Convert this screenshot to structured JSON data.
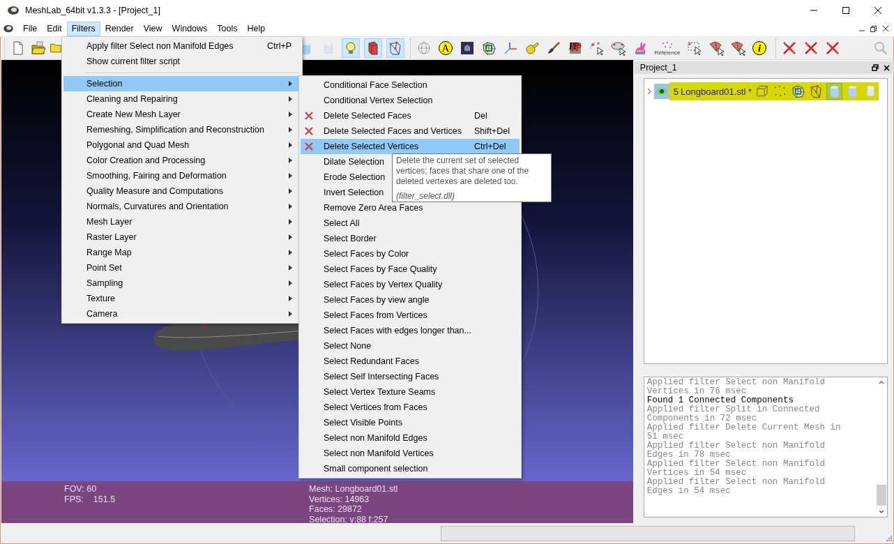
{
  "window": {
    "title": "MeshLab_64bit v1.3.3 - [Project_1]"
  },
  "menubar": [
    {
      "label": "File",
      "selected": false
    },
    {
      "label": "Edit",
      "selected": false
    },
    {
      "label": "Filters",
      "selected": true
    },
    {
      "label": "Render",
      "selected": false
    },
    {
      "label": "View",
      "selected": false
    },
    {
      "label": "Windows",
      "selected": false
    },
    {
      "label": "Tools",
      "selected": false
    },
    {
      "label": "Help",
      "selected": false
    }
  ],
  "toolbar": [
    [
      {
        "selected": false
      },
      {
        "selected": false
      },
      {
        "selected": false
      }
    ],
    [
      {
        "selected": false
      },
      {
        "selected": false
      },
      {
        "selected": true
      },
      {
        "selected": true
      },
      {
        "selected": true
      }
    ],
    [
      {
        "selected": false
      },
      {
        "selected": false,
        "label": "A"
      },
      {
        "selected": false
      },
      {
        "selected": false
      },
      {
        "selected": false
      },
      {
        "selected": false
      },
      {
        "selected": false
      },
      {
        "selected": false,
        "label": "PP"
      },
      {
        "selected": false
      },
      {
        "selected": false
      },
      {
        "selected": false
      },
      {
        "selected": false,
        "label": "Reference"
      },
      {
        "selected": false
      },
      {
        "selected": false
      },
      {
        "selected": false
      },
      {
        "selected": false,
        "label": "i"
      }
    ],
    [
      {
        "selected": false
      },
      {
        "selected": false
      },
      {
        "selected": false
      }
    ],
    [
      {
        "selected": false
      }
    ]
  ],
  "filters_menu": [
    {
      "kind": "action",
      "label": "Apply filter Select non Manifold Edges",
      "shortcut": "Ctrl+P",
      "selected": false
    },
    {
      "kind": "action",
      "label": "Show current filter script",
      "selected": false
    },
    {
      "kind": "separator"
    },
    {
      "kind": "submenu",
      "label": "Selection",
      "selected": true
    },
    {
      "kind": "submenu",
      "label": "Cleaning and Repairing",
      "selected": false
    },
    {
      "kind": "submenu",
      "label": "Create New Mesh Layer",
      "selected": false
    },
    {
      "kind": "submenu",
      "label": "Remeshing, Simplification and Reconstruction",
      "selected": false
    },
    {
      "kind": "submenu",
      "label": "Polygonal and Quad Mesh",
      "selected": false
    },
    {
      "kind": "submenu",
      "label": "Color Creation and Processing",
      "selected": false
    },
    {
      "kind": "submenu",
      "label": "Smoothing, Fairing and Deformation",
      "selected": false
    },
    {
      "kind": "submenu",
      "label": "Quality Measure and Computations",
      "selected": false
    },
    {
      "kind": "submenu",
      "label": "Normals, Curvatures and Orientation",
      "selected": false
    },
    {
      "kind": "submenu",
      "label": "Mesh Layer",
      "selected": false
    },
    {
      "kind": "submenu",
      "label": "Raster Layer",
      "selected": false
    },
    {
      "kind": "submenu",
      "label": "Range Map",
      "selected": false
    },
    {
      "kind": "submenu",
      "label": "Point Set",
      "selected": false
    },
    {
      "kind": "submenu",
      "label": "Sampling",
      "selected": false
    },
    {
      "kind": "submenu",
      "label": "Texture",
      "selected": false
    },
    {
      "kind": "submenu",
      "label": "Camera",
      "selected": false
    }
  ],
  "selection_menu": [
    {
      "kind": "plain",
      "label": "Conditional Face Selection",
      "selected": false
    },
    {
      "kind": "plain",
      "label": "Conditional Vertex Selection",
      "selected": false
    },
    {
      "kind": "iconed",
      "label": "Delete Selected Faces",
      "shortcut": "Del",
      "selected": false
    },
    {
      "kind": "iconed",
      "label": "Delete Selected Faces and Vertices",
      "shortcut": "Shift+Del",
      "selected": false
    },
    {
      "kind": "iconed",
      "label": "Delete Selected Vertices",
      "shortcut": "Ctrl+Del",
      "selected": true
    },
    {
      "kind": "plain",
      "label": "Dilate Selection",
      "selected": false
    },
    {
      "kind": "plain",
      "label": "Erode Selection",
      "selected": false
    },
    {
      "kind": "plain",
      "label": "Invert Selection",
      "selected": false
    },
    {
      "kind": "plain",
      "label": "Remove Zero Area Faces",
      "selected": false
    },
    {
      "kind": "plain",
      "label": "Select All",
      "selected": false
    },
    {
      "kind": "plain",
      "label": "Select Border",
      "selected": false
    },
    {
      "kind": "plain",
      "label": "Select Faces by Color",
      "selected": false
    },
    {
      "kind": "plain",
      "label": "Select Faces by Face Quality",
      "selected": false
    },
    {
      "kind": "plain",
      "label": "Select Faces by Vertex Quality",
      "selected": false
    },
    {
      "kind": "plain",
      "label": "Select Faces by view angle",
      "selected": false
    },
    {
      "kind": "plain",
      "label": "Select Faces from Vertices",
      "selected": false
    },
    {
      "kind": "plain",
      "label": "Select Faces with edges longer than...",
      "selected": false
    },
    {
      "kind": "plain",
      "label": "Select None",
      "selected": false
    },
    {
      "kind": "plain",
      "label": "Select Redundant Faces",
      "selected": false
    },
    {
      "kind": "plain",
      "label": "Select Self Intersecting Faces",
      "selected": false
    },
    {
      "kind": "plain",
      "label": "Select Vertex Texture Seams",
      "selected": false
    },
    {
      "kind": "plain",
      "label": "Select Vertices from Faces",
      "selected": false
    },
    {
      "kind": "plain",
      "label": "Select Visible Points",
      "selected": false
    },
    {
      "kind": "plain",
      "label": "Select non Manifold Edges",
      "selected": false
    },
    {
      "kind": "plain",
      "label": "Select non Manifold Vertices",
      "selected": false
    },
    {
      "kind": "plain",
      "label": "Small component selection",
      "selected": false
    }
  ],
  "tooltip": {
    "text": "Delete the current set of selected vertices; faces that share one of the deleted vertexes are deleted too.",
    "source": "(filter_select.dll)"
  },
  "viewport": {
    "fov": "FOV: 60",
    "fps_label": "FPS:",
    "fps": "151.5",
    "mesh_info": [
      "Mesh: Longboard01.stl",
      "Vertices: 14963",
      "Faces: 29872",
      "Selection: v:88 f:257"
    ]
  },
  "project_panel": {
    "title": "Project_1",
    "layers": [
      {
        "number": "5",
        "name": "Longboard01.stl *",
        "visible": true,
        "selected": true,
        "render_modes": [
          {
            "selected": false
          },
          {
            "selected": false
          },
          {
            "selected": false
          },
          {
            "selected": false
          },
          {
            "selected": true
          },
          {
            "selected": false
          },
          {
            "selected": false
          }
        ]
      }
    ]
  },
  "log": [
    {
      "kind": "info",
      "text": "Applied filter Select non Manifold Vertices in 76 msec"
    },
    {
      "kind": "result",
      "text": "Found 1 Connected Components"
    },
    {
      "kind": "info",
      "text": "Applied filter Split in Connected Components in 72 msec"
    },
    {
      "kind": "info",
      "text": "Applied filter Delete Current Mesh in 51 msec"
    },
    {
      "kind": "info",
      "text": "Applied filter Select non Manifold Edges in 78 msec"
    },
    {
      "kind": "info",
      "text": "Applied filter Select non Manifold Vertices in 54 msec"
    },
    {
      "kind": "info",
      "text": "Applied filter Select non Manifold Edges in 54 msec"
    }
  ]
}
